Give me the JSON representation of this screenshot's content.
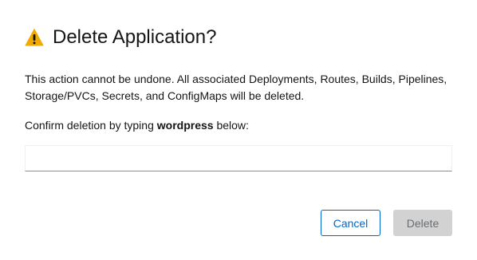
{
  "dialog": {
    "title": "Delete Application?",
    "icon": "warning-triangle-icon",
    "warning_color": "#f0ab00",
    "description": "This action cannot be undone. All associated Deployments, Routes, Builds, Pipelines, Storage/PVCs, Secrets, and ConfigMaps will be deleted.",
    "confirm_prefix": "Confirm deletion by typing ",
    "confirm_name": "wordpress",
    "confirm_suffix": " below:",
    "input_value": "",
    "cancel_label": "Cancel",
    "delete_label": "Delete",
    "delete_enabled": false
  }
}
